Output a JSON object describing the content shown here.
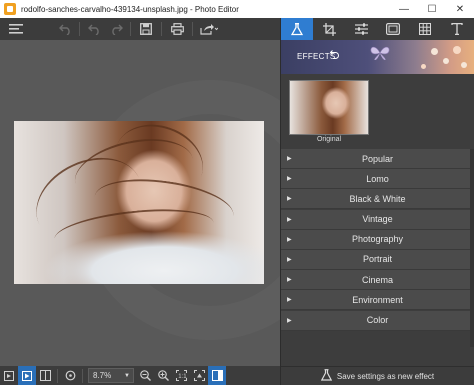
{
  "window": {
    "title": "rodolfo-sanches-carvalho-439134-unsplash.jpg - Photo Editor",
    "minimize": "—",
    "maximize": "☐",
    "close": "✕"
  },
  "toolbar": {
    "menu_icon": "menu-icon",
    "undo_icon": "undo-icon",
    "redo_icon": "redo-icon",
    "save_icon": "save-icon",
    "print_icon": "print-icon",
    "share_icon": "share-icon"
  },
  "bottom": {
    "zoom_value": "8.7%"
  },
  "panel": {
    "effects_title": "EFFECTS",
    "thumb_label": "Original",
    "categories": [
      {
        "label": "Popular"
      },
      {
        "label": "Lomo"
      },
      {
        "label": "Black & White"
      },
      {
        "label": "Vintage"
      },
      {
        "label": "Photography"
      },
      {
        "label": "Portrait"
      },
      {
        "label": "Cinema"
      },
      {
        "label": "Environment"
      },
      {
        "label": "Color"
      }
    ],
    "save_settings": "Save settings as new effect"
  },
  "colors": {
    "accent": "#2f7dd1",
    "panel_bg": "#3d3d3d",
    "canvas_bg": "#595959"
  }
}
